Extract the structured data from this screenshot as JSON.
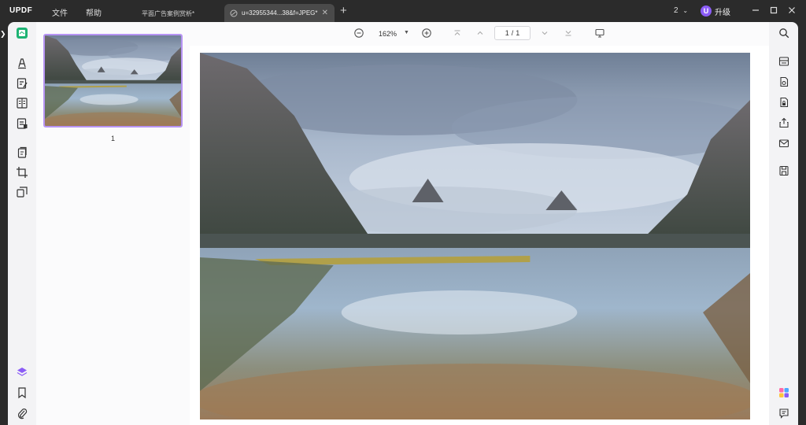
{
  "app": {
    "logo_text": "UPDF",
    "menu": [
      "文件",
      "帮助"
    ]
  },
  "tabs": [
    {
      "label": "平面广告案例赏析*",
      "active": false
    },
    {
      "label": "u=32955344...38&f=JPEG*",
      "active": true
    }
  ],
  "titlebar": {
    "page_count": "2",
    "upgrade_label": "升级",
    "avatar_letter": "U"
  },
  "toolbar": {
    "zoom": "162%",
    "current_page": "1",
    "page_separator": "/",
    "total_pages": "1"
  },
  "thumbnails": [
    {
      "page_label": "1",
      "selected": true
    }
  ],
  "colors": {
    "accent": "#8b5cf6",
    "thumb_border": "#b794f4",
    "tool_green": "#1db373",
    "titlebar_bg": "#2b2b2b"
  },
  "icons": {
    "left_tools": [
      "read-mode-icon",
      "comment-icon",
      "edit-pdf-icon",
      "page-layout-icon",
      "form-icon",
      "organize-pages-icon",
      "crop-icon",
      "compare-icon",
      "layers-icon",
      "bookmark-icon",
      "attachment-icon"
    ],
    "right_tools": [
      "search-icon",
      "ocr-icon",
      "convert-icon",
      "protect-icon",
      "share-icon",
      "email-icon",
      "save-icon",
      "updf-ai-icon",
      "comments-panel-icon"
    ]
  }
}
